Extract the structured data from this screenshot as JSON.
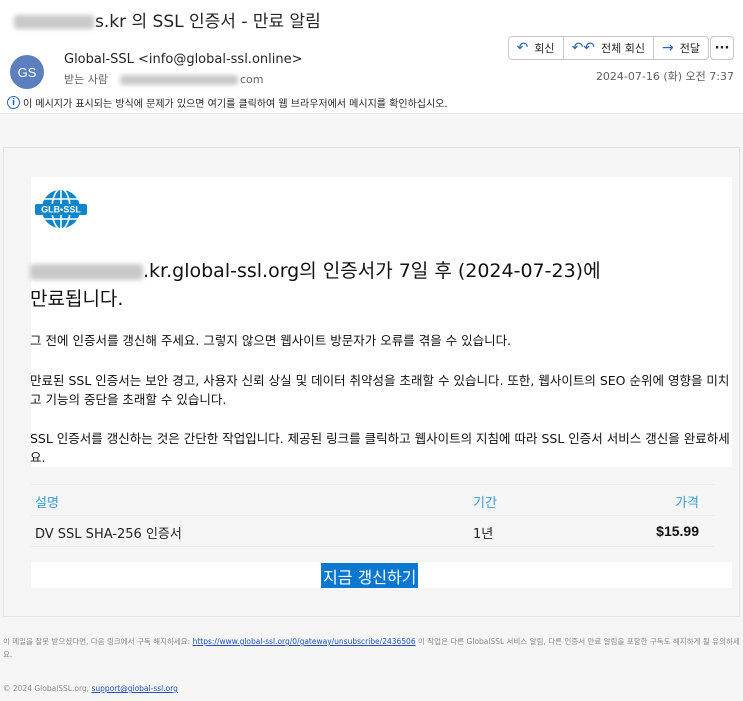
{
  "email": {
    "subject_suffix": "s.kr 의 SSL 인증서 - 만료 알림",
    "sender_initials": "GS",
    "from": "Global-SSL <info@global-ssl.online>",
    "to_label": "받는 사람",
    "to_suffix": "com",
    "date": "2024-07-16 (화) 오전 7:37",
    "info_bar": "이 메시지가 표시되는 방식에 문제가 있으면 여기를 클릭하여 웹 브라우저에서 메시지를 확인하십시오."
  },
  "actions": {
    "reply": "회신",
    "reply_all": "전체 회신",
    "forward": "전달",
    "more": "···"
  },
  "icons": {
    "reply": "reply-icon",
    "reply_all": "reply-all-icon",
    "forward": "forward-icon",
    "info": "info-icon",
    "logo": "globe-logo"
  },
  "body": {
    "logo_text": "GLB•SSL",
    "headline_part1": ".kr.global-ssl.org의 인증서가 7일 후 (2024-07-23)에",
    "headline_part2": "만료됩니다.",
    "p1": "그 전에 인증서를 갱신해 주세요. 그렇지 않으면 웹사이트 방문자가 오류를 겪을 수 있습니다.",
    "p2": "만료된 SSL 인증서는 보안 경고, 사용자 신뢰 상실 및 데이터 취약성을 초래할 수 있습니다. 또한, 웹사이트의 SEO 순위에 영향을 미치고 기능의 중단을 초래할 수 있습니다.",
    "p3": "SSL 인증서를 갱신하는 것은 간단한 작업입니다. 제공된 링크를 클릭하고 웹사이트의 지침에 따라 SSL 인증서 서비스 갱신을 완료하세요.",
    "table": {
      "headers": [
        "설명",
        "기간",
        "가격"
      ],
      "rows": [
        [
          "DV SSL SHA-256 인증서",
          "1년",
          "$15.99"
        ]
      ]
    },
    "renew_button": "지금 갱신하기"
  },
  "footer": {
    "text_before": "이 메일을 잘못 받으셨다면, 다음 링크에서 구독 해지하세요: ",
    "unsubscribe_link": "https://www.global-ssl.org/0/gateway/unsubscribe/2436506",
    "text_after": " 이 작업은 다른 GlobalSSL 서비스 알림, 다른 인증서 만료 알림을 포함한 구독도 해지하게 될 유의하세요.",
    "copyright": "© 2024 GlobalSSL.org, ",
    "support_email": "support@global-ssl.org"
  },
  "colors": {
    "accent": "#0a77d0",
    "table_header": "#3aa0d6",
    "avatar": "#5b7fbf",
    "link": "#2050c0"
  }
}
